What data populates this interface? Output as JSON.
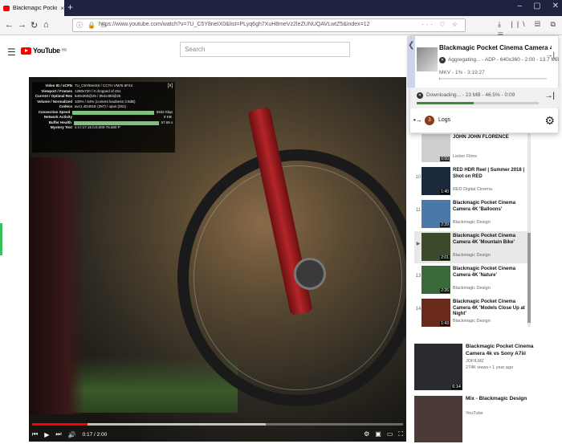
{
  "browser": {
    "tab_title": "Blackmagic Pocket Cinema C",
    "tab_close": "×",
    "new_tab": "+",
    "url": "https://www.youtube.com/watch?v=7U_C5Y8neIX0&list=PLyq6gh7XuH8meVz2leZUNUQAVLwtZ5&index=12",
    "url_icons": "ⓘ 🔒 ▭",
    "url_right": "··· ♡ ☆",
    "toolbar_icons": "⤓ ||\\ ▤ ⧉ ☰",
    "win_min": "–",
    "win_max": "▢",
    "win_close": "✕"
  },
  "youtube": {
    "logo_text": "YouTube",
    "logo_sup": "HK",
    "search_placeholder": "Search"
  },
  "stats": [
    {
      "k": "Video ID / sCPN",
      "v": "7U_C5Y8neIX0 / CCTH VM76 6F43"
    },
    {
      "k": "Viewport / Frames",
      "v": "1280x720 / 0 dropped of 451"
    },
    {
      "k": "Current / Optimal Res",
      "v": "640x360@25 / 854x480@25"
    },
    {
      "k": "Volume / Normalized",
      "v": "100% / 64% (content loudness 3.9dB)"
    },
    {
      "k": "Codecs",
      "v": "avc1.4D401E (397) / opus (251)"
    },
    {
      "k": "Connection Speed",
      "v": "5932 Kbps",
      "bar": 1.0
    },
    {
      "k": "Network Activity",
      "v": "0 KB",
      "bar": 0
    },
    {
      "k": "Buffer Health",
      "v": "57.65 s",
      "bar": 1.0
    },
    {
      "k": "Mystery Text",
      "v": "s:4 t:17.15 b:0.000-75.600 P"
    }
  ],
  "player": {
    "time": "0:17 / 2:00",
    "progress": 0.15,
    "buffered": 0.63
  },
  "playlist": [
    {
      "idx": "",
      "title": "JOHN JOHN FLORENCE",
      "channel": "Lieber Films",
      "duration": "0:50",
      "active": false,
      "color": "#cfcfcf"
    },
    {
      "idx": "10",
      "title": "RED HDR Reel | Summer 2018 | Shot on RED",
      "channel": "RED Digital Cinema",
      "duration": "1:40",
      "active": false,
      "color": "#1a2a3a"
    },
    {
      "idx": "11",
      "title": "Blackmagic Pocket Cinema Camera 4K 'Balloons'",
      "channel": "Blackmagic Design",
      "duration": "2:39",
      "active": false,
      "color": "#4a78a8"
    },
    {
      "idx": "▶",
      "title": "Blackmagic Pocket Cinema Camera 4K 'Mountain Bike'",
      "channel": "Blackmagic Design",
      "duration": "2:01",
      "active": true,
      "color": "#3a4a2a"
    },
    {
      "idx": "13",
      "title": "Blackmagic Pocket Cinema Camera 4K 'Nature'",
      "channel": "Blackmagic Design",
      "duration": "2:26",
      "active": false,
      "color": "#3a6a3a"
    },
    {
      "idx": "14",
      "title": "Blackmagic Pocket Cinema Camera 4K 'Models Close Up at Night'",
      "channel": "Blackmagic Design",
      "duration": "1:43",
      "active": false,
      "color": "#6a2a1a"
    }
  ],
  "recommendations": [
    {
      "title": "Blackmagic Pocket Cinema Camera 4k vs Sony A7iii",
      "channel": "JOFILMZ",
      "meta": "274K views • 1 year ago",
      "duration": "6:14",
      "color": "#2a2a30"
    },
    {
      "title": "Mix - Blackmagic Design",
      "channel": "YouTube",
      "meta": "",
      "duration": "",
      "color": "#4a3a38"
    }
  ],
  "downloader": {
    "title": "Blackmagic Pocket Cinema Camera 4K '...",
    "aggregating": "Aggregating... - ADP - 640x360 - 2:00 - 13.7 MB",
    "mkv": "MKV - 1% - 3:19.27",
    "mkv_progress": 0.01,
    "downloading": "Downloading... - 23 MB - 46.5% - 0:09",
    "dl_progress": 0.465,
    "badge": "3",
    "logs": "Logs",
    "more": "→|",
    "bullets": "•→",
    "gear": "⚙",
    "side_arrow": "❮",
    "stop": "✕"
  }
}
